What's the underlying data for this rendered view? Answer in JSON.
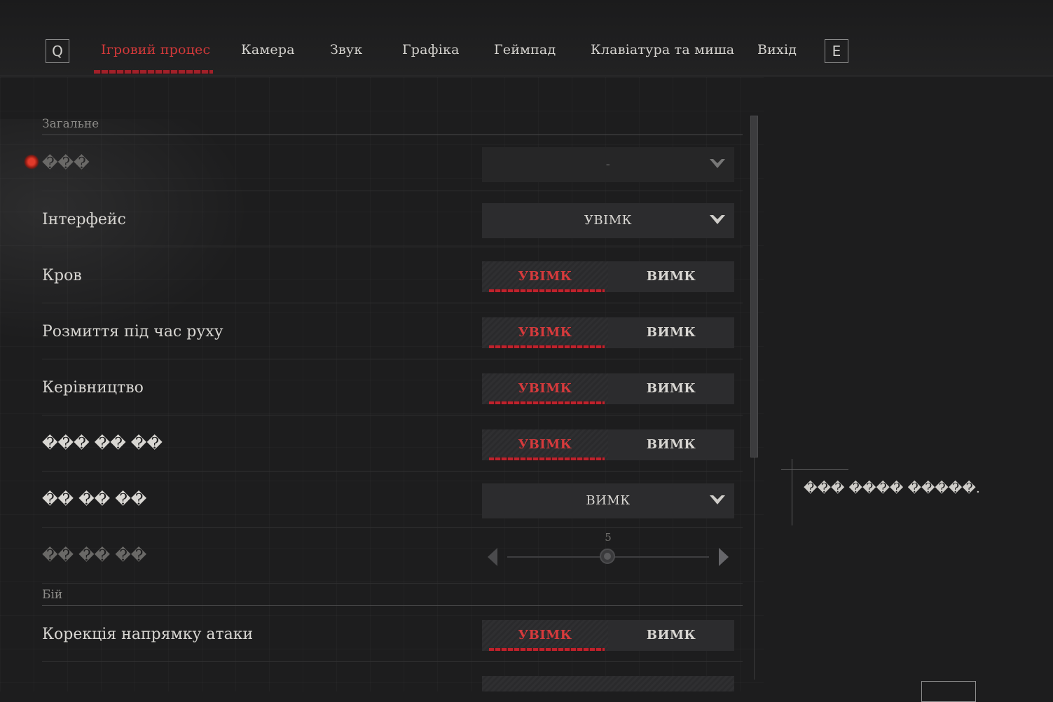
{
  "nav": {
    "prev_key": "Q",
    "next_key": "E",
    "tabs": [
      {
        "label": "Ігровий процес",
        "active": true
      },
      {
        "label": "Камера",
        "active": false
      },
      {
        "label": "Звук",
        "active": false
      },
      {
        "label": "Графіка",
        "active": false
      },
      {
        "label": "Геймпад",
        "active": false
      },
      {
        "label": "Клавіатура та миша",
        "active": false
      },
      {
        "label": "Вихід",
        "active": false
      }
    ]
  },
  "sections": {
    "general": "Загальне",
    "combat": "Бій"
  },
  "settings": {
    "row0": {
      "label": "���",
      "value": "-",
      "disabled": true
    },
    "row1": {
      "label": "Інтерфейс",
      "value": "УВІМК"
    },
    "row2": {
      "label": "Кров",
      "on": "УВІМК",
      "off": "ВИМК",
      "selected": "on"
    },
    "row3": {
      "label": "Розмиття під час руху",
      "on": "УВІМК",
      "off": "ВИМК",
      "selected": "on"
    },
    "row4": {
      "label": "Керівництво",
      "on": "УВІМК",
      "off": "ВИМК",
      "selected": "on"
    },
    "row5": {
      "label": "��� �� ��",
      "on": "УВІМК",
      "off": "ВИМК",
      "selected": "on"
    },
    "row6": {
      "label": "�� �� ��",
      "value": "ВИМК"
    },
    "row7": {
      "label": "�� �� ��",
      "value": "5",
      "disabled": true
    },
    "row8": {
      "label": "Корекція напрямку атаки",
      "on": "УВІМК",
      "off": "ВИМК",
      "selected": "on"
    }
  },
  "description": "��� ���� �����.",
  "colors": {
    "accent_red": "#d2393a",
    "background": "#1d1d1e",
    "control_bg": "#2c2c2e"
  }
}
